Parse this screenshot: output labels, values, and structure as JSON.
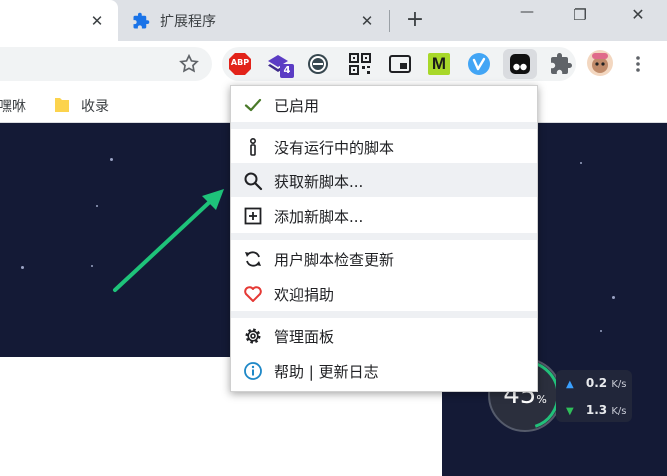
{
  "tabs": [
    {
      "title": "",
      "close": "✕"
    },
    {
      "title": "扩展程序",
      "close": "✕"
    }
  ],
  "newtab": "+",
  "window_controls": {
    "minimize": "—",
    "maximize": "❐",
    "close": "✕"
  },
  "extensions": {
    "abp_label": "ABP",
    "badge_count": "4",
    "m_label": "M"
  },
  "bookmarks": [
    {
      "label": "嘿咻"
    },
    {
      "label": "收录"
    }
  ],
  "menu": {
    "items": [
      {
        "label": "已启用",
        "icon": "check-icon"
      },
      {
        "label": "没有运行中的脚本",
        "icon": "info-i-icon"
      },
      {
        "label": "获取新脚本...",
        "icon": "search-icon"
      },
      {
        "label": "添加新脚本...",
        "icon": "add-box-icon"
      },
      {
        "label": "用户脚本检查更新",
        "icon": "refresh-icon"
      },
      {
        "label": "欢迎捐助",
        "icon": "heart-icon"
      },
      {
        "label": "管理面板",
        "icon": "gear-icon"
      },
      {
        "label": "帮助 | 更新日志",
        "icon": "info-circle-icon"
      }
    ]
  },
  "speed": {
    "percent": "45",
    "percent_sign": "%",
    "upload": "0.2",
    "download": "1.3",
    "unit": "K/s"
  },
  "colors": {
    "accent_green": "#1ec37a",
    "space_bg": "#141a36",
    "heart_red": "#e53935"
  }
}
